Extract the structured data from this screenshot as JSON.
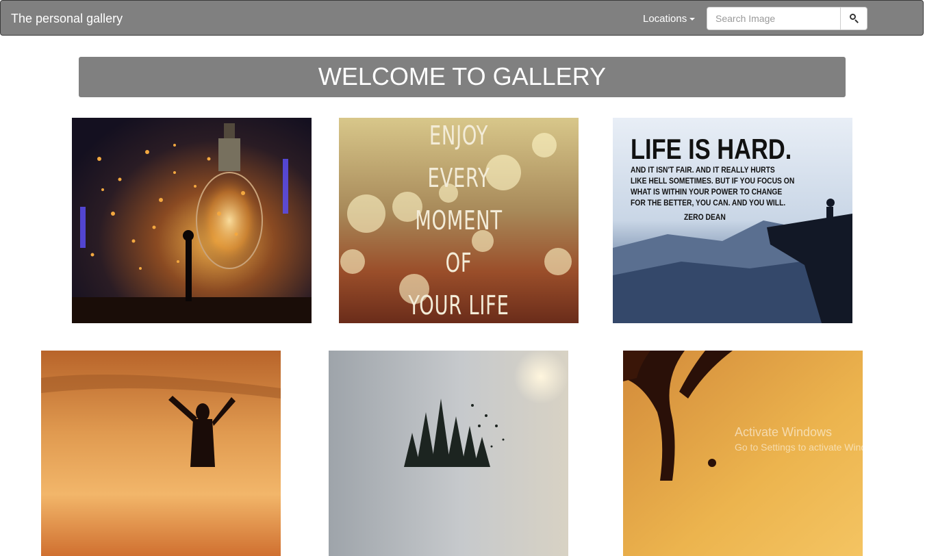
{
  "navbar": {
    "brand": "The personal gallery",
    "locations_label": "Locations",
    "search_placeholder": "Search Image"
  },
  "welcome": {
    "title": "WELCOME TO GALLERY"
  },
  "gallery": {
    "enjoy_lines": [
      "ENJOY",
      "EVERY",
      "MOMENT",
      "OF",
      "YOUR LIFE"
    ],
    "life_quote": {
      "headline": "LIFE IS HARD.",
      "body_lines": [
        "AND IT ISN'T FAIR. AND IT REALLY HURTS",
        "LIKE HELL SOMETIMES. BUT IF YOU FOCUS ON",
        "WHAT IS WITHIN YOUR POWER TO CHANGE",
        "FOR THE BETTER, YOU CAN. AND YOU WILL."
      ],
      "author": "ZERO DEAN"
    }
  },
  "watermark": {
    "title": "Activate Windows",
    "subtitle": "Go to Settings to activate Windows."
  },
  "colors": {
    "navbar_bg": "#808080",
    "welcome_bg": "#808080"
  }
}
